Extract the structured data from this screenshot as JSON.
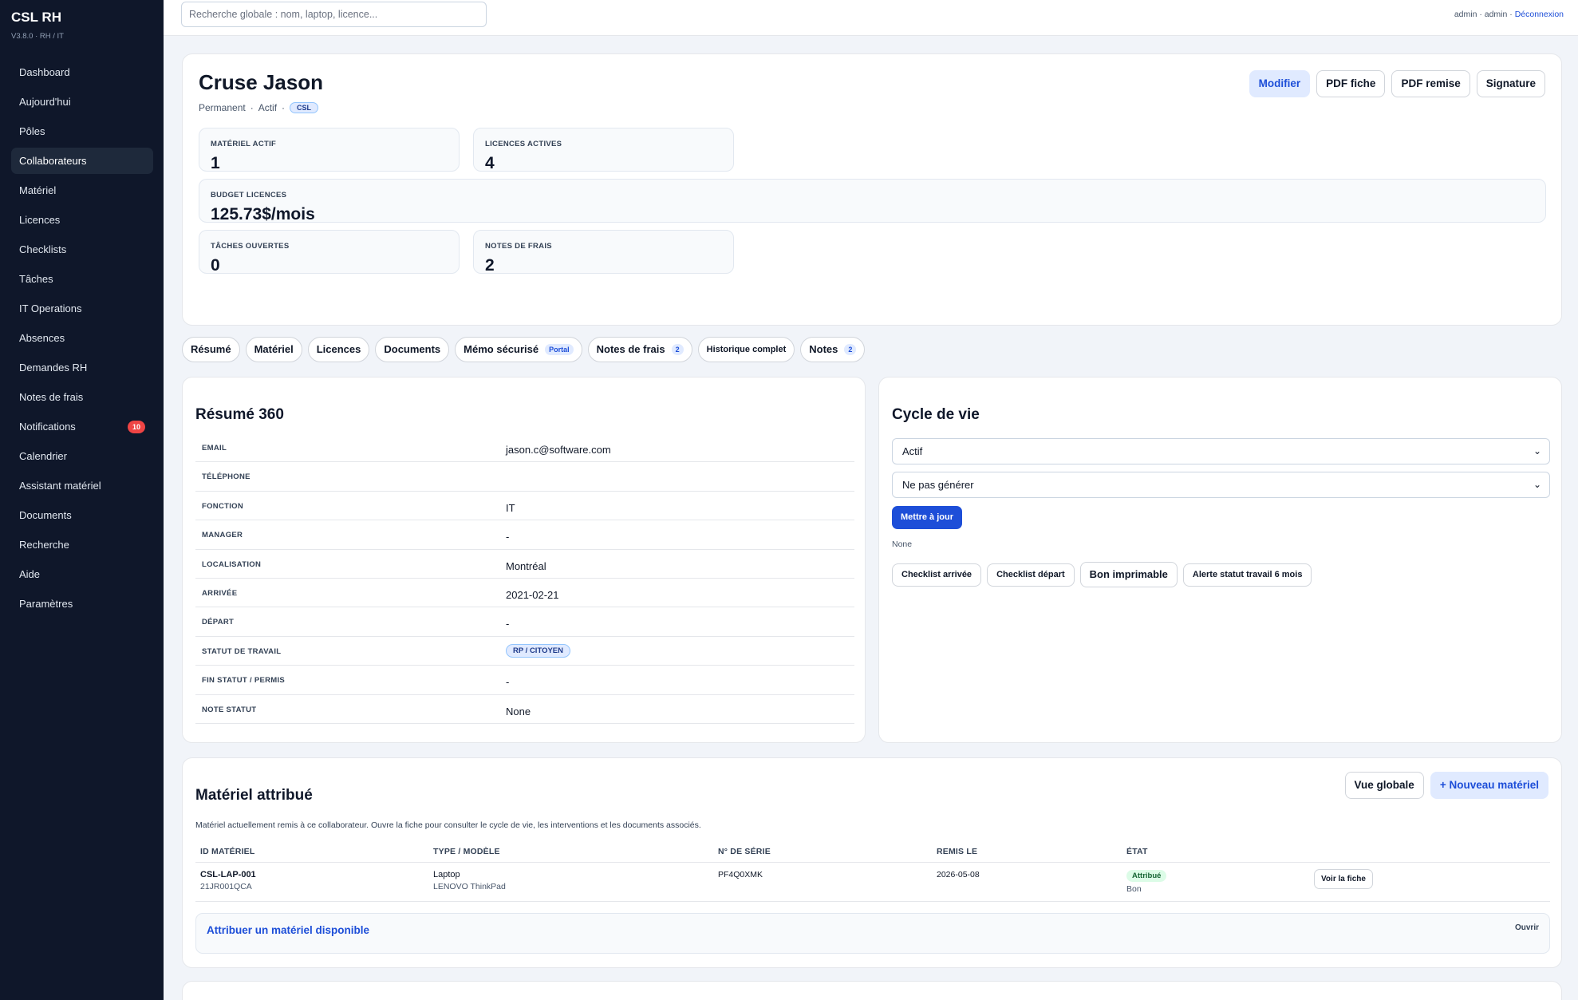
{
  "app": {
    "brand": "CSL RH",
    "version": "V3.8.0 · RH / IT"
  },
  "sidebar": {
    "items": [
      {
        "label": "Dashboard"
      },
      {
        "label": "Aujourd'hui"
      },
      {
        "label": "Pôles"
      },
      {
        "label": "Collaborateurs",
        "active": true
      },
      {
        "label": "Matériel"
      },
      {
        "label": "Licences"
      },
      {
        "label": "Checklists"
      },
      {
        "label": "Tâches"
      },
      {
        "label": "IT Operations"
      },
      {
        "label": "Absences"
      },
      {
        "label": "Demandes RH"
      },
      {
        "label": "Notes de frais"
      },
      {
        "label": "Notifications",
        "badge": "10"
      },
      {
        "label": "Calendrier"
      },
      {
        "label": "Assistant matériel"
      },
      {
        "label": "Documents"
      },
      {
        "label": "Recherche"
      },
      {
        "label": "Aide"
      },
      {
        "label": "Paramètres"
      }
    ]
  },
  "topbar": {
    "search_placeholder": "Recherche globale : nom, laptop, licence...",
    "user": "admin · admin ·",
    "logout": "Déconnexion"
  },
  "profile": {
    "name": "Cruse Jason",
    "contract": "Permanent",
    "status": "Actif",
    "company": "CSL",
    "separator": "·",
    "actions": {
      "edit": "Modifier",
      "pdf_sheet": "PDF fiche",
      "pdf_handover": "PDF remise",
      "signature": "Signature"
    }
  },
  "stats": {
    "material": {
      "label": "MATÉRIEL ACTIF",
      "value": "1"
    },
    "licences": {
      "label": "LICENCES ACTIVES",
      "value": "4"
    },
    "budget": {
      "label": "BUDGET LICENCES",
      "value": "125.73$/mois"
    },
    "tasks": {
      "label": "TÂCHES OUVERTES",
      "value": "0"
    },
    "expenses": {
      "label": "NOTES DE FRAIS",
      "value": "2"
    }
  },
  "tabs": {
    "resume": "Résumé",
    "materiel": "Matériel",
    "licences": "Licences",
    "documents": "Documents",
    "memo": "Mémo sécurisé",
    "memo_tag": "Portal",
    "notes_frais": "Notes de frais",
    "notes_frais_count": "2",
    "historique": "Historique complet",
    "notes": "Notes",
    "notes_count": "2"
  },
  "summary": {
    "title": "Résumé 360",
    "rows": {
      "email": {
        "label": "EMAIL",
        "value": "jason.c@software.com"
      },
      "phone": {
        "label": "TÉLÉPHONE",
        "value": ""
      },
      "function": {
        "label": "FONCTION",
        "value": "IT"
      },
      "manager": {
        "label": "MANAGER",
        "value": "-"
      },
      "location": {
        "label": "LOCALISATION",
        "value": "Montréal"
      },
      "arrival": {
        "label": "ARRIVÉE",
        "value": "2021-02-21"
      },
      "departure": {
        "label": "DÉPART",
        "value": "-"
      },
      "work_status": {
        "label": "STATUT DE TRAVAIL",
        "value": "RP / CITOYEN"
      },
      "status_end": {
        "label": "FIN STATUT / PERMIS",
        "value": "-"
      },
      "status_note": {
        "label": "NOTE STATUT",
        "value": "None"
      }
    }
  },
  "lifecycle": {
    "title": "Cycle de vie",
    "state_select": "Actif",
    "generate_select": "Ne pas générer",
    "update_button": "Mettre à jour",
    "note": "None",
    "actions": {
      "arrival": "Checklist arrivée",
      "departure": "Checklist départ",
      "printable": "Bon imprimable",
      "alert": "Alerte statut travail 6 mois"
    }
  },
  "materials": {
    "title": "Matériel attribué",
    "subtitle": "Matériel actuellement remis à ce collaborateur. Ouvre la fiche pour consulter le cycle de vie, les interventions et les documents associés.",
    "global_view": "Vue globale",
    "new_material": "+ Nouveau matériel",
    "columns": {
      "id": "ID MATÉRIEL",
      "type": "TYPE / MODÈLE",
      "serial": "N° DE SÉRIE",
      "date": "REMIS LE",
      "state": "ÉTAT"
    },
    "row": {
      "id": "CSL-LAP-001",
      "id_sub": "21JR001QCA",
      "type": "Laptop",
      "model": "LENOVO ThinkPad",
      "serial": "PF4Q0XMK",
      "date": "2026-05-08",
      "state": "Attribué",
      "condition": "Bon",
      "view": "Voir la fiche"
    },
    "assign_link": "Attribuer un matériel disponible",
    "assign_open": "Ouvrir"
  }
}
